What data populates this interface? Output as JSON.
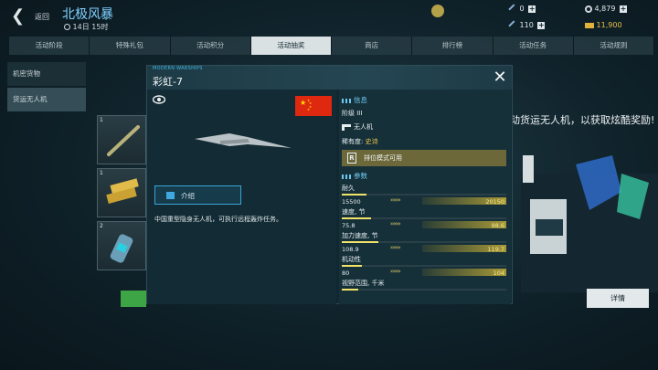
{
  "header": {
    "back_label": "返回",
    "title": "北极风暴",
    "timer": "14日 15时"
  },
  "resources": {
    "coin_a": "0",
    "wrench": "0",
    "silver": "4,879",
    "parts": "110",
    "gold": "11,900"
  },
  "tabs": [
    "活动阶段",
    "特殊礼包",
    "活动积分",
    "活动抽奖",
    "商店",
    "排行榜",
    "活动任务",
    "活动规则"
  ],
  "active_tab": 3,
  "sidebar": {
    "items": [
      "机密货物",
      "货运无人机"
    ]
  },
  "cards": [
    {
      "count": "1"
    },
    {
      "count": "1"
    },
    {
      "count": "2"
    }
  ],
  "background": {
    "promo_text": "动货运无人机，以获取炫酷奖励!",
    "detail_button": "详情"
  },
  "modal": {
    "tag": "MODERN WARSHIPS",
    "title": "彩虹-7",
    "intro_button": "介绍",
    "description": "中国重型隐身无人机，可执行远程轰炸任务。",
    "info_title": "信息",
    "tier_label": "阶级 III",
    "class_label": "无人机",
    "rarity_label": "稀有度:",
    "rarity_value": "史诗",
    "rank_text": "排位模式可用",
    "params_title": "参数",
    "stats": [
      {
        "name": "耐久",
        "base": "15500",
        "max": "20150",
        "fill": 0.15,
        "gain_from": 0.42
      },
      {
        "name": "速度, 节",
        "base": "75.8",
        "max": "98.6",
        "fill": 0.18,
        "gain_from": 0.42
      },
      {
        "name": "加力速度, 节",
        "base": "108.9",
        "max": "119.7",
        "fill": 0.22,
        "gain_from": 0.42
      },
      {
        "name": "机动性",
        "base": "80",
        "max": "104",
        "fill": 0.12,
        "gain_from": 0.42
      },
      {
        "name": "视野范围, 千米",
        "base": "",
        "max": "",
        "fill": 0.1,
        "gain_from": 0.42
      }
    ]
  },
  "colors": {
    "accent": "#3fb7e6",
    "rarity": "#e8c24a",
    "stat_bar": "#f1e36a",
    "flag": "#de2910"
  }
}
